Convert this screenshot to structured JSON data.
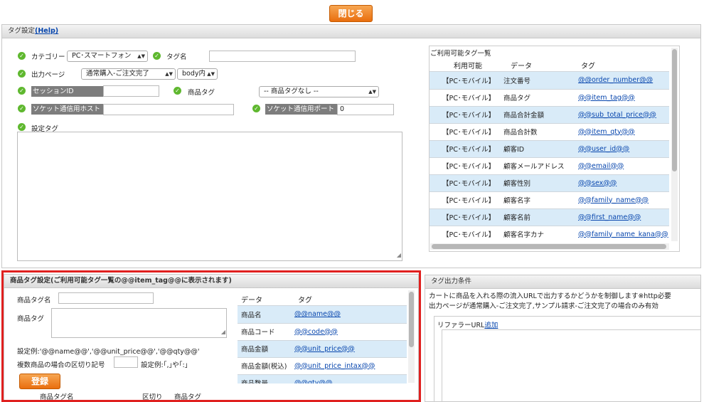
{
  "close_button": "閉じる",
  "tag_settings": {
    "title": "タグ設定",
    "help": "(Help)",
    "category_label": "カテゴリー",
    "category_value": "PC･スマートフォン",
    "tag_name_label": "タグ名",
    "tag_name_value": "",
    "output_page_label": "出力ページ",
    "output_page_value": "通常購入-ご注文完了",
    "position_value": "body内",
    "session_id_label": "セッションID",
    "product_tag_label": "商品タグ",
    "product_tag_value": "-- 商品タグなし --",
    "socket_host_label": "ソケット通信用ホスト",
    "socket_port_label": "ソケット通信用ポート",
    "socket_port_value": "0",
    "setting_tag_label": "設定タグ"
  },
  "available_tags": {
    "title": "ご利用可能タグ一覧",
    "col_usable": "利用可能",
    "col_data": "データ",
    "col_tag": "タグ",
    "rows": [
      {
        "usable": "【PC･モバイル】",
        "data": "注文番号",
        "tag": "@@order_number@@"
      },
      {
        "usable": "【PC･モバイル】",
        "data": "商品タグ",
        "tag": "@@item_tag@@"
      },
      {
        "usable": "【PC･モバイル】",
        "data": "商品合計金額",
        "tag": "@@sub_total_price@@"
      },
      {
        "usable": "【PC･モバイル】",
        "data": "商品合計数",
        "tag": "@@item_qty@@"
      },
      {
        "usable": "【PC･モバイル】",
        "data": "顧客ID",
        "tag": "@@user_id@@"
      },
      {
        "usable": "【PC･モバイル】",
        "data": "顧客メールアドレス",
        "tag": "@@email@@"
      },
      {
        "usable": "【PC･モバイル】",
        "data": "顧客性別",
        "tag": "@@sex@@"
      },
      {
        "usable": "【PC･モバイル】",
        "data": "顧客名字",
        "tag": "@@family_name@@"
      },
      {
        "usable": "【PC･モバイル】",
        "data": "顧客名前",
        "tag": "@@first_name@@"
      },
      {
        "usable": "【PC･モバイル】",
        "data": "顧客名字カナ",
        "tag": "@@family_name_kana@@"
      }
    ]
  },
  "item_tag_settings": {
    "title": "商品タグ設定(ご利用可能タグ一覧の@@item_tag@@に表示されます)",
    "name_label": "商品タグ名",
    "tag_label": "商品タグ",
    "example": "設定例:'@@name@@','@@unit_price@@','@@qty@@'",
    "separator_label": "複数商品の場合の区切り記号",
    "separator_example": "設定例:｢,｣や｢:｣",
    "register_button": "登録",
    "list_col_name": "商品タグ名",
    "list_col_sep": "区切り",
    "list_col_tag": "商品タグ",
    "data_col": "データ",
    "tag_col": "タグ",
    "rows": [
      {
        "data": "商品名",
        "tag": "@@name@@"
      },
      {
        "data": "商品コード",
        "tag": "@@code@@"
      },
      {
        "data": "商品金額",
        "tag": "@@unit_price@@"
      },
      {
        "data": "商品金額(税込)",
        "tag": "@@unit_price_intax@@"
      },
      {
        "data": "商品数量",
        "tag": "@@qty@@"
      }
    ]
  },
  "output_conditions": {
    "title": "タグ出力条件",
    "desc1": "カートに商品を入れる際の流入URLで出力するかどうかを制御します※http必要",
    "desc2": "出力ページが通常購入-ご注文完了,サンプル請求-ご注文完了の場合のみ有効",
    "referrer_label": "リファラーURL",
    "add_link": "追加"
  }
}
